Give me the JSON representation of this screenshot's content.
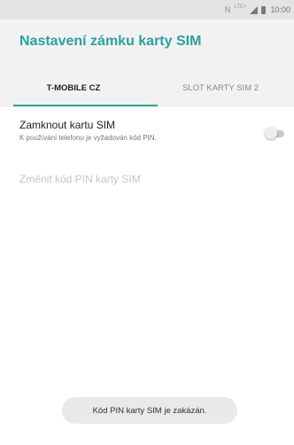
{
  "status_bar": {
    "nfc_icon": "N",
    "lte_label": "LTE+",
    "time": "10:00",
    "icons": [
      "nfc-icon",
      "lte-icon",
      "signal-icon",
      "battery-icon"
    ]
  },
  "app_bar": {
    "title": "Nastavení zámku karty SIM",
    "accent_color": "#2aa39a"
  },
  "tabs": [
    {
      "label": "T-MOBILE CZ",
      "selected": true
    },
    {
      "label": "SLOT KARTY SIM 2",
      "selected": false
    }
  ],
  "settings": {
    "lock_sim": {
      "title": "Zamknout kartu SIM",
      "summary": "K používání telefonu je vyžadován kód PIN.",
      "enabled": false
    },
    "change_pin": {
      "title": "Změnit kód PIN karty SIM",
      "enabled": false
    }
  },
  "toast": {
    "message": "Kód PIN karty SIM je zakázán."
  }
}
